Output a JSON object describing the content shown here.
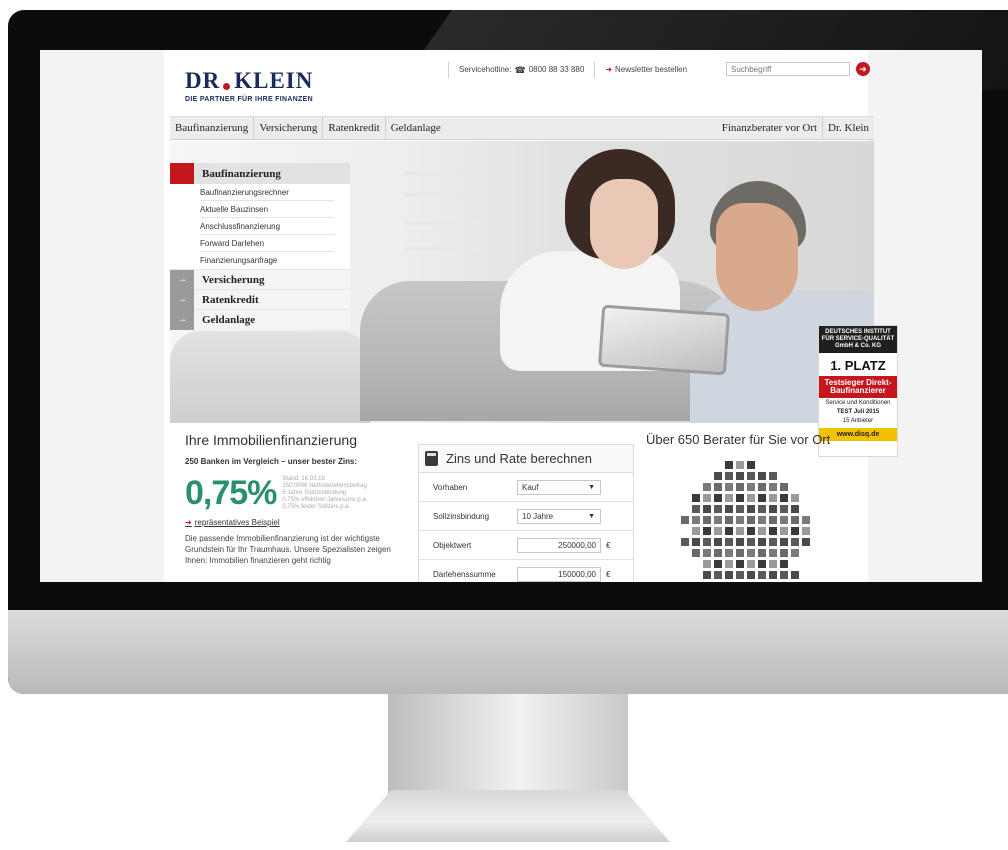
{
  "site": {
    "logo_brand_left": "DR",
    "logo_brand_right": "KLEIN",
    "logo_tagline": "DIE PARTNER FÜR IHRE FINANZEN"
  },
  "topbar": {
    "servicehotline_label": "Servicehotline:",
    "servicehotline_number": "0800 88 33 880",
    "newsletter_label": "Newsletter bestellen",
    "search_placeholder": "Suchbegriff"
  },
  "mainnav": {
    "left": [
      "Baufinanzierung",
      "Versicherung",
      "Ratenkredit",
      "Geldanlage"
    ],
    "right": [
      "Finanzberater vor Ort",
      "Dr. Klein"
    ]
  },
  "submenu": {
    "active": "Baufinanzierung",
    "links": [
      "Baufinanzierungsrechner",
      "Aktuelle Bauzinsen",
      "Anschlussfinanzierung",
      "Forward Darlehen",
      "Finanzierungsanfrage"
    ],
    "categories": [
      "Versicherung",
      "Ratenkredit",
      "Geldanlage"
    ]
  },
  "badge": {
    "institute": "DEUTSCHES INSTITUT FÜR SERVICE-QUALITÄT GmbH & Co. KG",
    "place": "1. PLATZ",
    "award": "Testsieger Direkt-Baufinanzierer",
    "service": "Service und Konditionen",
    "test": "TEST Juli 2015",
    "anbieter": "15 Anbieter",
    "url": "www.disq.de"
  },
  "financing": {
    "heading": "Ihre Immobilienfinanzierung",
    "subheading": "250 Banken im Vergleich – unser bester Zins:",
    "rate": "0,75%",
    "notes": [
      "Stand: 16.03.16",
      "150.000€ Nettodarlehensbetrag",
      "5 Jahre Sollzinsbindung",
      "0,75% effektiver Jahreszins p.a.",
      "0,75% fester Sollzins p.a."
    ],
    "example_link": "repräsentatives Beispiel",
    "body": "Die passende Immobilienfinanzierung ist der wichtigste Grundstein für Ihr Traumhaus. Unsere Spezialisten zeigen Ihnen: Immobilien finanzieren geht richtig"
  },
  "calculator": {
    "title": "Zins und Rate berechnen",
    "rows": [
      {
        "label": "Vorhaben",
        "value": "Kauf",
        "kind": "select"
      },
      {
        "label": "Sollzinsbindung",
        "value": "10 Jahre",
        "kind": "select"
      },
      {
        "label": "Objektwert",
        "value": "250000,00",
        "kind": "input",
        "unit": "€"
      },
      {
        "label": "Darlehenssumme",
        "value": "150000,00",
        "kind": "input",
        "unit": "€"
      }
    ]
  },
  "advisors": {
    "heading": "Über 650 Berater für Sie vor Ort"
  },
  "colors": {
    "brand_red": "#c4161c",
    "brand_navy": "#1b2a5a",
    "rate_green": "#2a8f6b"
  }
}
